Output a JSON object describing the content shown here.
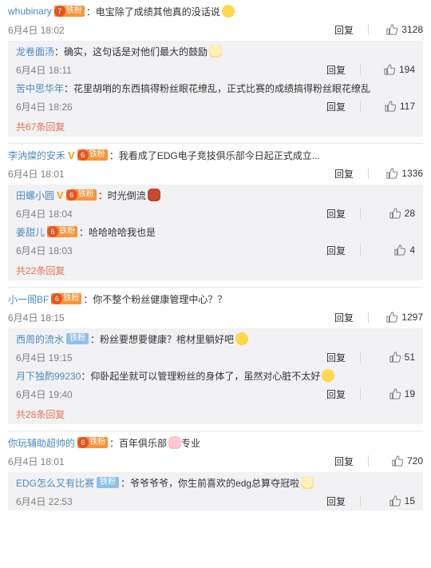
{
  "comments": [
    {
      "user": "whubinary",
      "badge": "铁粉",
      "text": "电宝除了成绩其他真的没话说",
      "time": "6月4日 18:02",
      "reply": "回复",
      "likes": "3128",
      "replies": [
        {
          "user": "龙卷面汤",
          "text": "确实，这句话是对他们最大的鼓励",
          "time": "6月4日 18:11",
          "reply": "回复",
          "likes": "194"
        },
        {
          "user": "苦中思华年",
          "text": "花里胡哨的东西搞得粉丝眼花缭乱，正式比赛的成绩搞得粉丝眼花缭乱",
          "time": "6月4日 18:26",
          "reply": "回复",
          "likes": "117"
        }
      ],
      "more": "共67条回复"
    },
    {
      "user": "李汭燦的安禾",
      "badge": "铁粉",
      "text": "我看成了EDG电子竞技俱乐部今日起正式成立...",
      "time": "6月4日 18:01",
      "reply": "回复",
      "likes": "1336",
      "replies": [
        {
          "user": "田螺小圆",
          "badge": "铁粉",
          "text": "时光倒流",
          "time": "6月4日 18:04",
          "reply": "回复",
          "likes": "28"
        },
        {
          "user": "姜甜儿",
          "badge": "铁粉",
          "text": "哈哈哈哈我也是",
          "time": "6月4日 18:03",
          "reply": "回复",
          "likes": "4"
        }
      ],
      "more": "共22条回复"
    },
    {
      "user": "小一阁BF",
      "badge": "铁粉",
      "text": "你不整个粉丝健康管理中心？？",
      "time": "6月4日 18:15",
      "reply": "回复",
      "likes": "1297",
      "replies": [
        {
          "user": "西周的流水",
          "badge": "铁粉",
          "text": "粉丝要想要健康？棺材里躺好吧",
          "time": "6月4日 19:15",
          "reply": "回复",
          "likes": "51"
        },
        {
          "user": "月下独酌99230",
          "text": "仰卧起坐就可以管理粉丝的身体了，虽然对心脏不太好",
          "time": "6月4日 19:40",
          "reply": "回复",
          "likes": "19"
        }
      ],
      "more": "共28条回复"
    },
    {
      "user": "你玩辅助超帅的",
      "badge": "铁粉",
      "text": "百年俱乐部",
      "text2": "专业",
      "time": "6月4日 18:01",
      "reply": "回复",
      "likes": "720",
      "replies": [
        {
          "user": "EDG怎么又有比赛",
          "badge": "铁粉",
          "text": "爷爷爷爷，你生前喜欢的edg总算夺冠啦",
          "time": "6月4日 22:53",
          "reply": "回复",
          "likes": "15"
        }
      ]
    }
  ],
  "colon": "：",
  "icons": {
    "like": "thumbs-up-icon",
    "emoji": "emoji-icon",
    "badge": "fan-badge-icon",
    "vip": "vip-v-icon"
  },
  "colors": {
    "username": "#eb7350",
    "reply_username": "#4a8bc2",
    "subbox_bg": "#f2f2f5",
    "badge": "#f8943c"
  }
}
